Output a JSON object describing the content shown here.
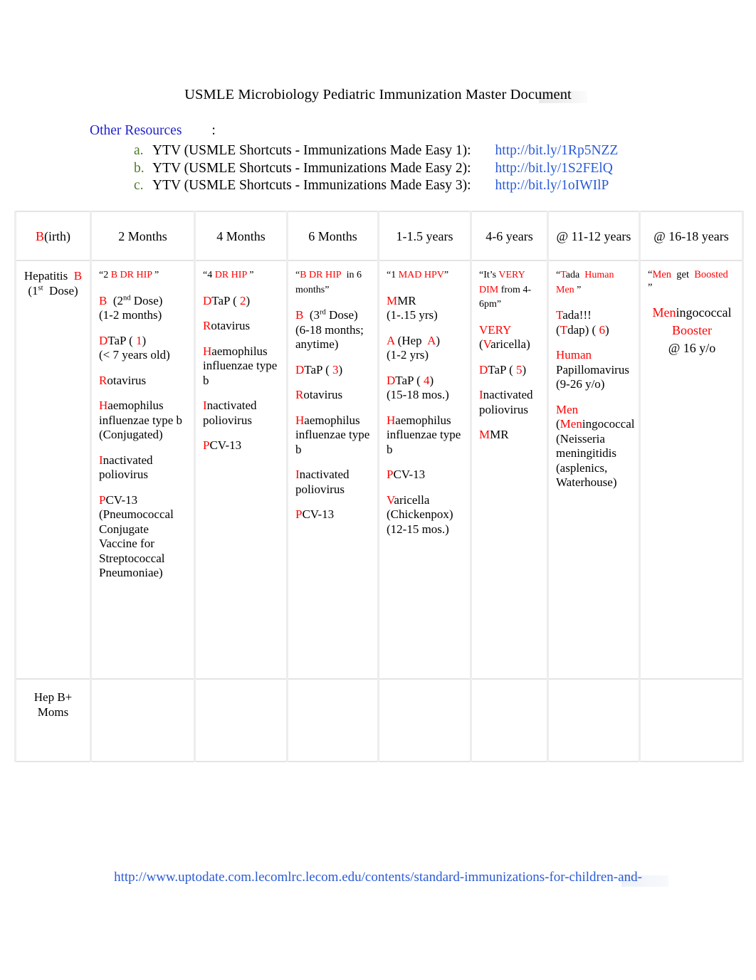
{
  "document": {
    "title": "USMLE Microbiology Pediatric Immunization Master Document",
    "footer_link": "http://www.uptodate.com.lecomlrc.lecom.edu/contents/standard-immunizations-for-children-and-"
  },
  "resources": {
    "heading": "Other Resources",
    "colon": ":",
    "items": [
      {
        "marker": "a.",
        "text": "YTV (USMLE Shortcuts - Immunizations Made Easy 1):",
        "link": "http://bit.ly/1Rp5NZZ"
      },
      {
        "marker": "b.",
        "text": "YTV (USMLE Shortcuts - Immunizations Made Easy 2):",
        "link": "http://bit.ly/1S2FElQ"
      },
      {
        "marker": "c.",
        "text": "YTV (USMLE Shortcuts - Immunizations Made Easy 3):",
        "link": "http://bit.ly/1oIWIlP"
      }
    ]
  },
  "table": {
    "headers": [
      {
        "red_prefix": "B",
        "rest": "(irth)"
      },
      {
        "red_prefix": "",
        "rest": "2 Months"
      },
      {
        "red_prefix": "",
        "rest": "4 Months"
      },
      {
        "red_prefix": "",
        "rest": "6 Months"
      },
      {
        "red_prefix": "",
        "rest": "1-1.5 years"
      },
      {
        "red_prefix": "",
        "rest": "4-6 years"
      },
      {
        "red_prefix": "",
        "rest": "@ 11-12 years"
      },
      {
        "red_prefix": "",
        "rest": "@ 16-18 years"
      }
    ],
    "columns": {
      "birth": {
        "mnemonic": "",
        "entries": [
          "Hepatitis B",
          "(1st Dose)"
        ]
      },
      "two_months": {
        "mnemonic": "“2 B DR HIP ”",
        "entries": [
          "B (2nd Dose) (1-2 months)",
          "DTaP ( 1) (< 7 years old)",
          "Rotavirus",
          "Haemophilus influenzae type b (Conjugated)",
          "Inactivated poliovirus",
          "PCV-13 (Pneumococcal Conjugate Vaccine for Streptococcal Pneumoniae)"
        ]
      },
      "four_months": {
        "mnemonic": "“4 DR HIP ”",
        "entries": [
          "DTaP ( 2)",
          "Rotavirus",
          "Haemophilus influenzae type b",
          "Inactivated poliovirus",
          "PCV-13"
        ]
      },
      "six_months": {
        "mnemonic": "“B DR HIP  in 6 months”",
        "entries": [
          "B (3rd Dose) (6-18 months; anytime)",
          "DTaP ( 3)",
          "Rotavirus",
          "Haemophilus influenzae type b",
          "Inactivated poliovirus",
          "PCV-13"
        ]
      },
      "one_to_onefive_years": {
        "mnemonic": "“1 MAD HPV”",
        "entries": [
          "MMR (1-.15 yrs)",
          "A (Hep A) (1-2 yrs)",
          "DTaP ( 4) (15-18 mos.)",
          "Haemophilus influenzae type b",
          "PCV-13",
          "Varicella (Chickenpox) (12-15 mos.)"
        ]
      },
      "four_to_six_years": {
        "mnemonic": "“It’s VERY DIM from 4-6pm”",
        "entries": [
          "VERY (Varicella)",
          "DTaP ( 5)",
          "Inactivated poliovirus",
          "MMR"
        ]
      },
      "eleven_to_twelve_years": {
        "mnemonic": "“Tada  Human Men ”",
        "entries": [
          "Tada!!! (Tdap) ( 6)",
          "Human Papillomavirus (9-26 y/o)",
          "Men (Meningococcal (Neisseria meningitidis (asplenics, Waterhouse)"
        ]
      },
      "sixteen_to_eighteen_years": {
        "mnemonic": "“Men  get  Boosted  ”",
        "entries": [
          "Meningococcal",
          "Booster",
          "@ 16 y/o"
        ]
      }
    },
    "bottom_row": {
      "first_cell": "Hep B+ Moms",
      "empty_cells": [
        "",
        "",
        "",
        "",
        "",
        "",
        ""
      ]
    }
  }
}
